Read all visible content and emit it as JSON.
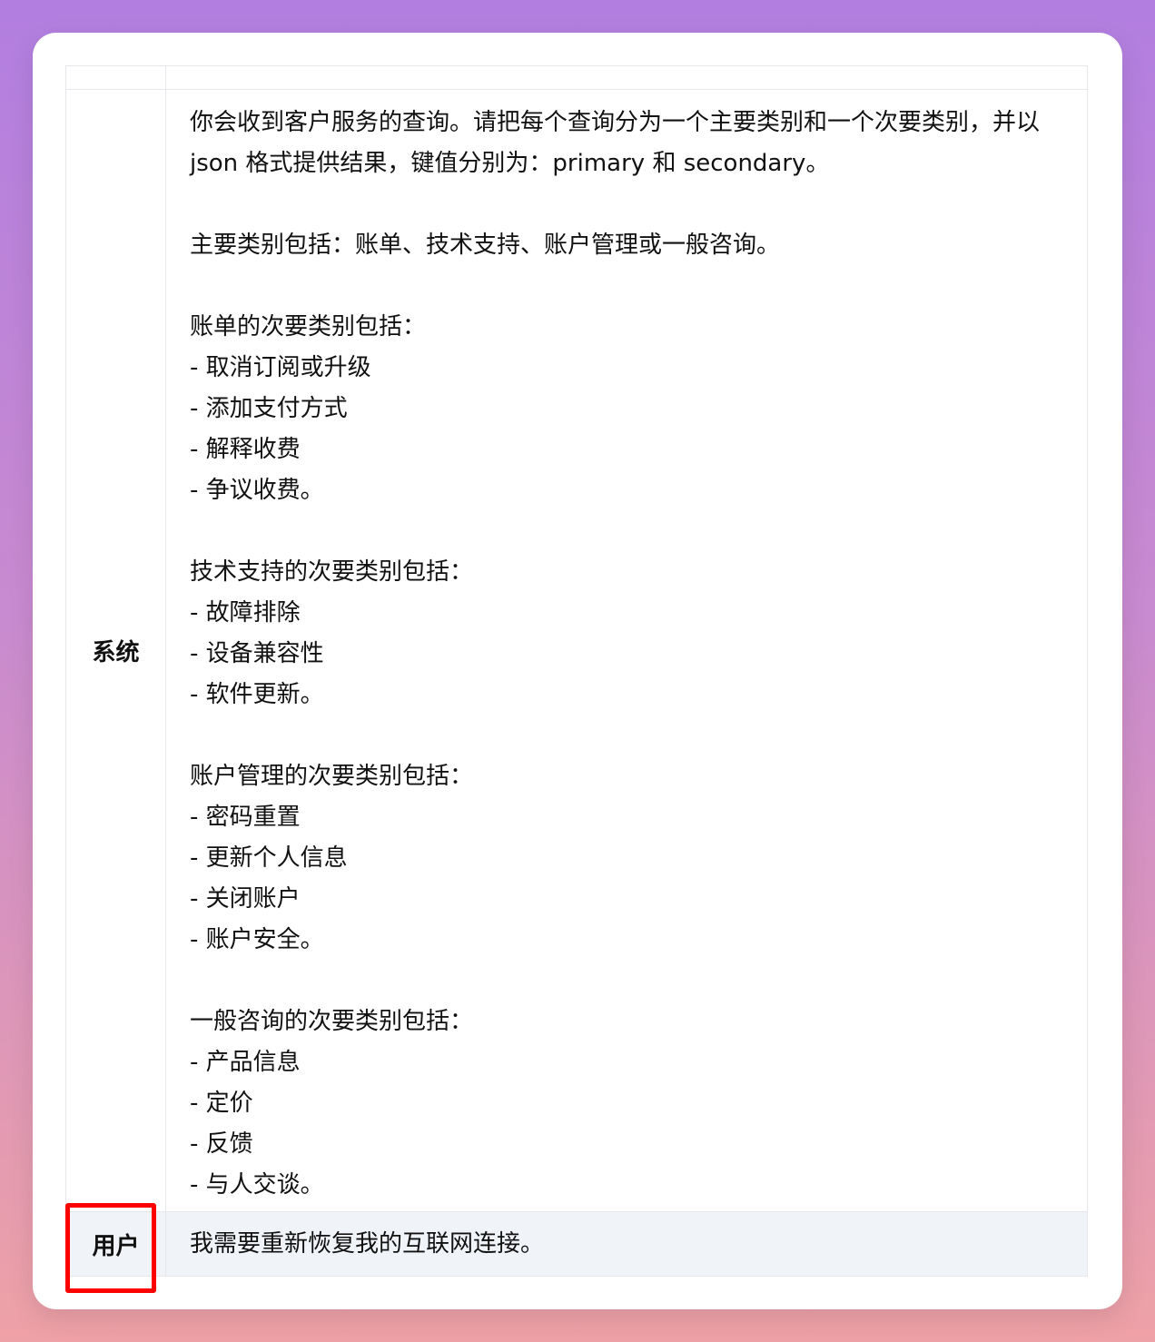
{
  "table": {
    "header": {
      "role": "",
      "content": ""
    },
    "rows": [
      {
        "role": "系统",
        "lines": [
          "你会收到客户服务的查询。请把每个查询分为一个主要类别和一个次要类别，并以 json 格式提供结果，键值分别为：primary 和 secondary。",
          "",
          "主要类别包括：账单、技术支持、账户管理或一般咨询。",
          "",
          "账单的次要类别包括：",
          "- 取消订阅或升级",
          "- 添加支付方式",
          "- 解释收费",
          "- 争议收费。",
          "",
          "技术支持的次要类别包括：",
          "- 故障排除",
          "- 设备兼容性",
          "- 软件更新。",
          "",
          "账户管理的次要类别包括：",
          "- 密码重置",
          "- 更新个人信息",
          "- 关闭账户",
          "- 账户安全。",
          "",
          "一般咨询的次要类别包括：",
          "- 产品信息",
          "- 定价",
          "- 反馈",
          "- 与人交谈。"
        ]
      },
      {
        "role": "用户",
        "content": "我需要重新恢复我的互联网连接。"
      }
    ]
  },
  "colors": {
    "highlight": "#ff0000",
    "user_row_bg": "#f0f3f8",
    "border": "#e5e7eb"
  }
}
